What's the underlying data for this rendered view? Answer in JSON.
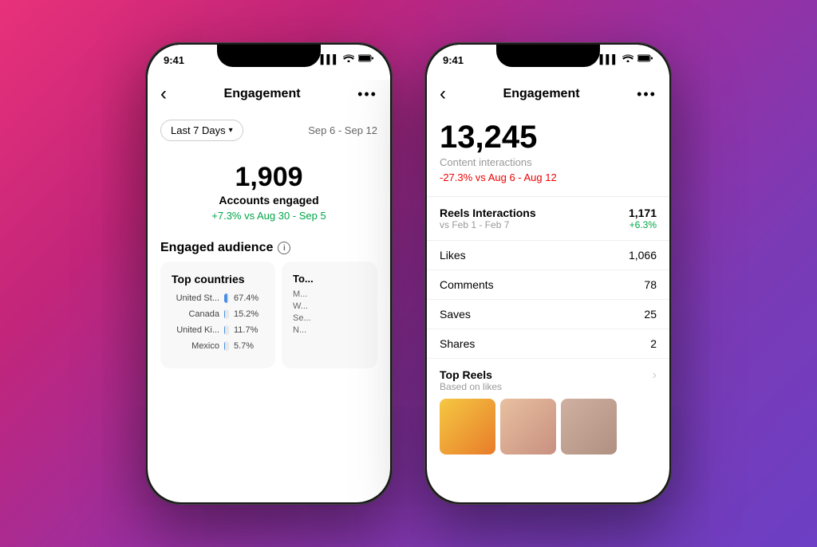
{
  "background": {
    "gradient_start": "#e8317a",
    "gradient_end": "#6c3fc4"
  },
  "phone1": {
    "status_bar": {
      "time": "9:41",
      "signal": "▌▌▌",
      "wifi": "wifi",
      "battery": "battery"
    },
    "nav": {
      "back_icon": "‹",
      "title": "Engagement",
      "more_icon": "•••"
    },
    "filter": {
      "period_label": "Last 7 Days",
      "arrow": "▾",
      "date_range": "Sep 6 - Sep 12"
    },
    "main_stat": {
      "number": "1,909",
      "label": "Accounts engaged",
      "change": "+7.3% vs Aug 30 - Sep 5"
    },
    "engaged_audience": {
      "title": "Engaged audience",
      "has_info": true
    },
    "top_countries": {
      "card_title": "Top countries",
      "items": [
        {
          "label": "United St...",
          "pct_value": 67.4,
          "pct_label": "67.4%"
        },
        {
          "label": "Canada",
          "pct_value": 15.2,
          "pct_label": "15.2%"
        },
        {
          "label": "United Ki...",
          "pct_value": 11.7,
          "pct_label": "11.7%"
        },
        {
          "label": "Mexico",
          "pct_value": 5.7,
          "pct_label": "5.7%"
        }
      ]
    },
    "second_card": {
      "title": "To...",
      "items": [
        "M...",
        "W...",
        "Se...",
        "N..."
      ]
    }
  },
  "phone2": {
    "status_bar": {
      "time": "9:41",
      "signal": "▌▌▌",
      "wifi": "wifi",
      "battery": "battery"
    },
    "nav": {
      "back_icon": "‹",
      "title": "Engagement",
      "more_icon": "•••"
    },
    "main_stat": {
      "number": "13,245",
      "sublabel": "Content interactions",
      "change": "-27.3% vs Aug 6 - Aug 12"
    },
    "reels_section": {
      "title": "Reels Interactions",
      "subtitle": "vs Feb 1 - Feb 7",
      "value": "1,171",
      "change": "+6.3%"
    },
    "metrics": [
      {
        "label": "Likes",
        "value": "1,066"
      },
      {
        "label": "Comments",
        "value": "78"
      },
      {
        "label": "Saves",
        "value": "25"
      },
      {
        "label": "Shares",
        "value": "2"
      }
    ],
    "top_reels": {
      "title": "Top Reels",
      "sublabel": "Based on likes",
      "chevron": "›"
    }
  }
}
